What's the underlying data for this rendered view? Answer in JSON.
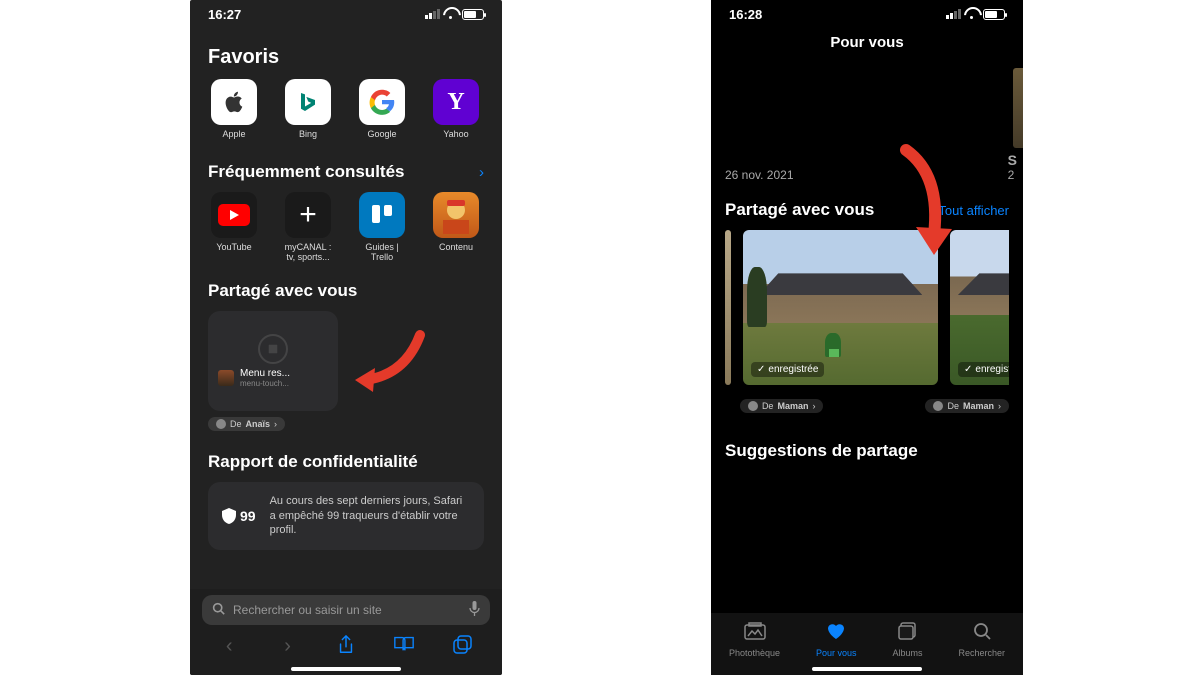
{
  "left": {
    "time": "16:27",
    "favorites": {
      "title": "Favoris",
      "items": [
        {
          "label": "Apple"
        },
        {
          "label": "Bing"
        },
        {
          "label": "Google"
        },
        {
          "label": "Yahoo"
        }
      ]
    },
    "frequent": {
      "title": "Fréquemment consultés",
      "items": [
        {
          "label": "YouTube"
        },
        {
          "label": "myCANAL : tv, sports..."
        },
        {
          "label": "Guides | Trello"
        },
        {
          "label": "Contenu"
        }
      ]
    },
    "shared": {
      "title": "Partagé avec vous",
      "card": {
        "title": "Menu res...",
        "sub": "menu-touch..."
      },
      "from_prefix": "De",
      "from": "Anaïs"
    },
    "privacy": {
      "title": "Rapport de confidentialité",
      "count": "99",
      "text": "Au cours des sept derniers jours, Safari a empêché 99 traqueurs d'établir votre profil."
    },
    "search_placeholder": "Rechercher ou saisir un site"
  },
  "right": {
    "time": "16:28",
    "header": "Pour vous",
    "memory_date": "26 nov. 2021",
    "memory_title_cut": "S",
    "memory_date_cut": "2",
    "shared": {
      "title": "Partagé avec vous",
      "show_all": "Tout afficher",
      "saved_label": "enregistrée",
      "from_prefix": "De",
      "from1": "Maman",
      "from2": "Maman"
    },
    "suggestions_title": "Suggestions de partage",
    "tabs": {
      "library": "Photothèque",
      "for_you": "Pour vous",
      "albums": "Albums",
      "search": "Rechercher"
    }
  }
}
